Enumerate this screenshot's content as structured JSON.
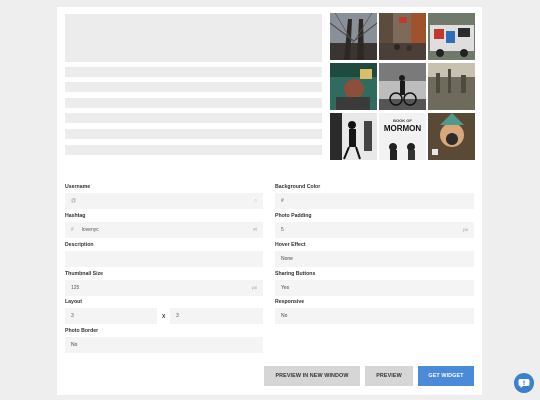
{
  "grid": {
    "tiles": [
      "brooklyn-bridge-photo",
      "street-crowd-photo",
      "graffiti-truck-photo",
      "subway-art-photo",
      "cyclist-photo",
      "city-skyline-photo",
      "dancers-bw-photo",
      "book-of-mormon-poster-photo",
      "statue-liberty-cap-photo"
    ],
    "poster_text": [
      "BOOK OF",
      "MORMON"
    ]
  },
  "form": {
    "username": {
      "label": "Username",
      "prefix": "@",
      "value": ""
    },
    "hashtag": {
      "label": "Hashtag",
      "prefix": "#",
      "value": "lovenyc"
    },
    "description": {
      "label": "Description",
      "value": ""
    },
    "thumbnail_size": {
      "label": "Thumbnail Size",
      "value": "125",
      "suffix": "px"
    },
    "layout": {
      "label": "Layout",
      "cols": "3",
      "separator": "X",
      "rows": "3"
    },
    "photo_border": {
      "label": "Photo Border",
      "value": "No"
    },
    "background_color": {
      "label": "Background Color",
      "value": "#"
    },
    "photo_padding": {
      "label": "Photo Padding",
      "value": "5",
      "suffix": "px"
    },
    "hover_effect": {
      "label": "Hover Effect",
      "value": "None"
    },
    "sharing_buttons": {
      "label": "Sharing Buttons",
      "value": "Yes"
    },
    "responsive": {
      "label": "Responsive",
      "value": "No"
    }
  },
  "actions": {
    "preview_new_window": "PREVIEW IN NEW WINDOW",
    "preview": "PREVIEW",
    "get_widget": "GET WIDGET"
  },
  "icons": {
    "username_status": "circle-icon",
    "hashtag_status": "hash-icon",
    "chat": "chat-bubble-icon"
  },
  "colors": {
    "accent": "#4a8ad9",
    "button_grey": "#d6d6d6",
    "field_bg": "#f4f4f4"
  }
}
